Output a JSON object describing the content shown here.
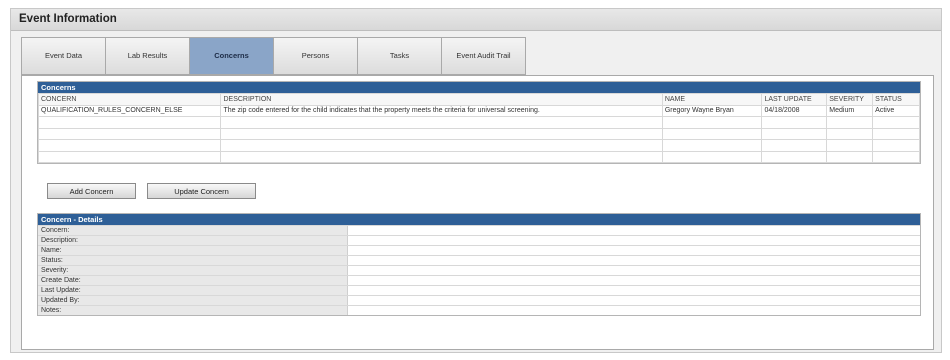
{
  "window": {
    "title": "Event Information"
  },
  "tabs": [
    {
      "label": "Event Data",
      "active": false
    },
    {
      "label": "Lab Results",
      "active": false
    },
    {
      "label": "Concerns",
      "active": true
    },
    {
      "label": "Persons",
      "active": false
    },
    {
      "label": "Tasks",
      "active": false
    },
    {
      "label": "Event Audit Trail",
      "active": false
    }
  ],
  "concerns": {
    "title": "Concerns",
    "columns": [
      "CONCERN",
      "DESCRIPTION",
      "NAME",
      "LAST UPDATE",
      "SEVERITY",
      "STATUS"
    ],
    "rows": [
      [
        "QUALIFICATION_RULES_CONCERN_ELSE",
        "The zip code entered for the child indicates that the property meets the criteria for universal screening.",
        "Gregory Wayne Bryan",
        "04/18/2008",
        "Medium",
        "Active"
      ]
    ]
  },
  "buttons": {
    "add_concern": "Add Concern",
    "update_concern": "Update Concern"
  },
  "details": {
    "title": "Concern - Details",
    "fields": [
      "Concern:",
      "Description:",
      "Name:",
      "Status:",
      "Severity:",
      "Create Date:",
      "Last Update:",
      "Updated By:",
      "Notes:"
    ]
  },
  "colors": {
    "header_blue": "#2e5f97",
    "active_tab": "#8aa5c8"
  }
}
